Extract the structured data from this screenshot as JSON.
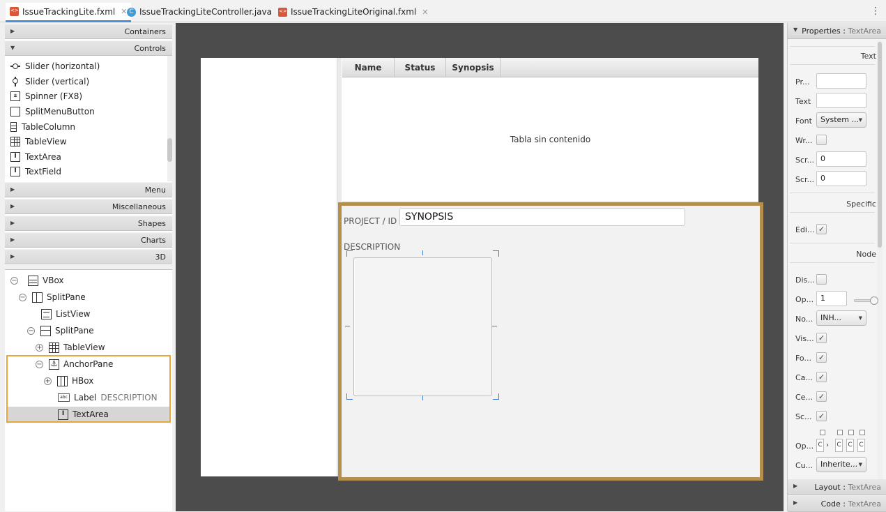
{
  "tabs": [
    {
      "label": "IssueTrackingLite.fxml",
      "icon": "fxml-file-icon",
      "active": true
    },
    {
      "label": "IssueTrackingLiteController.java",
      "icon": "java-class-icon",
      "active": false
    },
    {
      "label": "IssueTrackingLiteOriginal.fxml",
      "icon": "fxml-file-icon",
      "active": false
    }
  ],
  "library": {
    "sections": {
      "containers": "Containers",
      "controls": "Controls",
      "menu": "Menu",
      "miscellaneous": "Miscellaneous",
      "shapes": "Shapes",
      "charts": "Charts",
      "three_d": "3D"
    },
    "controls": [
      {
        "label": "Slider  (horizontal)",
        "icon": "slider-horizontal-icon"
      },
      {
        "label": "Slider  (vertical)",
        "icon": "slider-vertical-icon"
      },
      {
        "label": "Spinner  (FX8)",
        "icon": "spinner-icon"
      },
      {
        "label": "SplitMenuButton",
        "icon": "split-menu-button-icon"
      },
      {
        "label": "TableColumn",
        "icon": "table-column-icon"
      },
      {
        "label": "TableView",
        "icon": "table-view-icon"
      },
      {
        "label": "TextArea",
        "icon": "text-area-icon"
      },
      {
        "label": "TextField",
        "icon": "text-field-icon"
      }
    ]
  },
  "hierarchy": {
    "nodes": [
      {
        "label": "VBox",
        "icon": "vbox-icon",
        "toggle": "−"
      },
      {
        "label": "SplitPane",
        "icon": "splitpane-vertical-icon",
        "toggle": "−"
      },
      {
        "label": "ListView",
        "icon": "listview-icon",
        "toggle": ""
      },
      {
        "label": "SplitPane",
        "icon": "splitpane-horizontal-icon",
        "toggle": "−"
      },
      {
        "label": "TableView",
        "icon": "tableview-icon",
        "toggle": "+"
      },
      {
        "label": "AnchorPane",
        "icon": "anchorpane-icon",
        "toggle": "−"
      },
      {
        "label": "HBox",
        "icon": "hbox-icon",
        "toggle": "+"
      },
      {
        "label": "Label",
        "secondary": "DESCRIPTION",
        "icon": "label-icon",
        "toggle": ""
      },
      {
        "label": "TextArea",
        "icon": "textarea-icon",
        "toggle": "",
        "selected": true
      }
    ]
  },
  "canvas": {
    "table_columns": [
      "Name",
      "Status",
      "Synopsis"
    ],
    "table_empty_message": "Tabla sin contenido",
    "project_label": "PROJECT / ID",
    "synopsis_value": "SYNOPSIS",
    "description_label": "DESCRIPTION"
  },
  "inspector": {
    "properties_title": "Properties",
    "layout_title": "Layout",
    "code_title": "Code",
    "target": "TextArea",
    "sections": {
      "text": "Text",
      "specific": "Specific",
      "node": "Node"
    },
    "text_props": {
      "prompt_label": "Pr...",
      "prompt_value": "",
      "text_label": "Text",
      "text_value": "",
      "font_label": "Font",
      "font_value": "System ...",
      "wrap_label": "Wr...",
      "scroll_left_label": "Scr...",
      "scroll_left_value": "0",
      "scroll_top_label": "Scr...",
      "scroll_top_value": "0"
    },
    "specific_props": {
      "editable_label": "Edi...",
      "editable_checked": "✓"
    },
    "node_props": {
      "disable_label": "Dis...",
      "opacity_label": "Op...",
      "opacity_value": "1",
      "node_orientation_label": "No...",
      "node_orientation_value": "INH...",
      "visible_label": "Vis...",
      "focus_traversable_label": "Fo...",
      "cache_label": "Ca...",
      "cache_shape_label": "Ce...",
      "scale_shape_label": "Sc...",
      "opaque_insets_label": "Op...",
      "cursor_label": "Cu...",
      "cursor_value": "Inherite...",
      "check_mark": "✓",
      "opaque_insets_values": [
        "C",
        "C",
        "C",
        "C"
      ],
      "opaque_insets_separator": "›"
    }
  },
  "colors": {
    "selection_outline": "#e8a73c",
    "anchor_border": "#b5904c",
    "handle_blue": "#3a7bd5",
    "canvas_bg": "#4c4c4c"
  }
}
